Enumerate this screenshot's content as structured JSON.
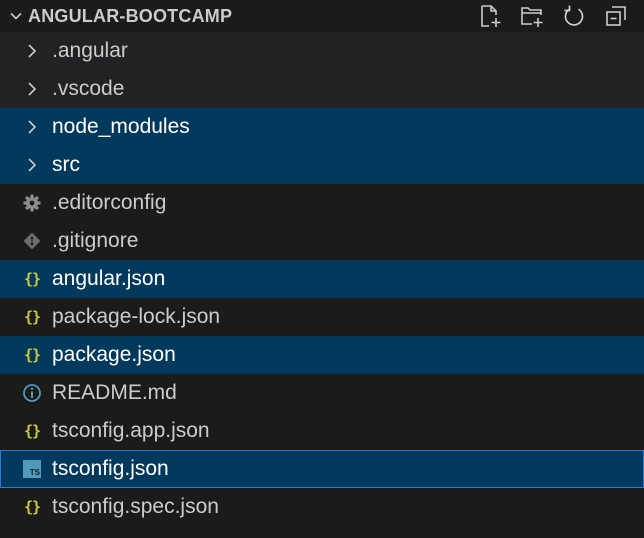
{
  "explorer": {
    "title": "ANGULAR-BOOTCAMP",
    "actions": [
      {
        "name": "new-file-icon"
      },
      {
        "name": "new-folder-icon"
      },
      {
        "name": "refresh-icon"
      },
      {
        "name": "collapse-all-icon"
      }
    ],
    "items": [
      {
        "label": ".angular",
        "kind": "folder",
        "icon": "chevron-right-icon",
        "selected": false
      },
      {
        "label": ".vscode",
        "kind": "folder",
        "icon": "chevron-right-icon",
        "selected": false
      },
      {
        "label": "node_modules",
        "kind": "folder",
        "icon": "chevron-right-icon",
        "selected": true
      },
      {
        "label": "src",
        "kind": "folder",
        "icon": "chevron-right-icon",
        "selected": true
      },
      {
        "label": ".editorconfig",
        "kind": "file",
        "icon": "gear-icon",
        "selected": false
      },
      {
        "label": ".gitignore",
        "kind": "file",
        "icon": "git-icon",
        "selected": false
      },
      {
        "label": "angular.json",
        "kind": "file",
        "icon": "json-braces-icon",
        "selected": true
      },
      {
        "label": "package-lock.json",
        "kind": "file",
        "icon": "json-braces-icon",
        "selected": false
      },
      {
        "label": "package.json",
        "kind": "file",
        "icon": "json-braces-icon",
        "selected": true
      },
      {
        "label": "README.md",
        "kind": "file",
        "icon": "info-icon",
        "selected": false
      },
      {
        "label": "tsconfig.app.json",
        "kind": "file",
        "icon": "json-braces-icon",
        "selected": false
      },
      {
        "label": "tsconfig.json",
        "kind": "file",
        "icon": "typescript-icon",
        "selected": true,
        "focused": true
      },
      {
        "label": "tsconfig.spec.json",
        "kind": "file",
        "icon": "json-braces-icon",
        "selected": false
      }
    ],
    "icon_text": {
      "braces": "{}",
      "ts": "TS"
    },
    "colors": {
      "selection": "#04395e",
      "focus_border": "#2b7ad6",
      "json_icon": "#cbcb41",
      "ts_icon": "#519aba",
      "background": "#1b1b1c"
    }
  }
}
